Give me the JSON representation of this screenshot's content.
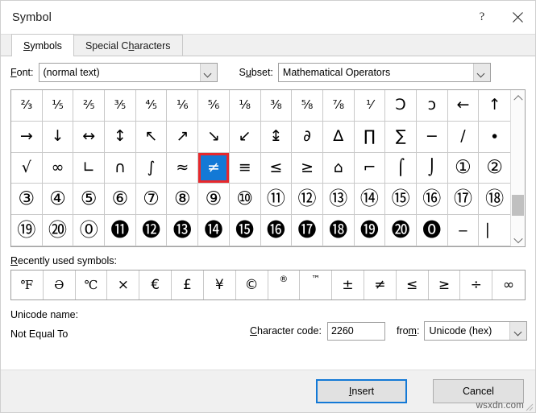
{
  "window": {
    "title": "Symbol",
    "help_icon": "help-icon",
    "close_icon": "close-icon"
  },
  "tabs": [
    {
      "label": "Symbols",
      "accel_index": 0,
      "active": true
    },
    {
      "label": "Special Characters",
      "accel_index": 9,
      "active": false
    }
  ],
  "fields": {
    "font_label": "Font:",
    "font_label_accel": 0,
    "font_value": "(normal text)",
    "subset_label": "Subset:",
    "subset_label_accel": 1,
    "subset_value": "Mathematical Operators",
    "character_code_label": "Character code:",
    "character_code_accel": 0,
    "character_code_value": "2260",
    "from_label": "from:",
    "from_label_accel": 3,
    "from_value": "Unicode (hex)",
    "unicode_name_label": "Unicode name:",
    "unicode_name_value": "Not Equal To"
  },
  "grid": {
    "columns": 16,
    "rows": 5,
    "selected_index": 38,
    "selected_char": "≠",
    "selection_fill": "#1379d6",
    "selection_border": "#e8282c",
    "cells": [
      {
        "ch": "⅔",
        "cls": "small"
      },
      {
        "ch": "⅕",
        "cls": "small"
      },
      {
        "ch": "⅖",
        "cls": "small"
      },
      {
        "ch": "⅗",
        "cls": "small"
      },
      {
        "ch": "⅘",
        "cls": "small"
      },
      {
        "ch": "⅙",
        "cls": "small"
      },
      {
        "ch": "⅚",
        "cls": "small"
      },
      {
        "ch": "⅛",
        "cls": "small"
      },
      {
        "ch": "⅜",
        "cls": "small"
      },
      {
        "ch": "⅝",
        "cls": "small"
      },
      {
        "ch": "⅞",
        "cls": "small"
      },
      {
        "ch": "⅟",
        "cls": "small"
      },
      {
        "ch": "Ↄ",
        "cls": ""
      },
      {
        "ch": "ɔ",
        "cls": ""
      },
      {
        "ch": "←",
        "cls": ""
      },
      {
        "ch": "↑",
        "cls": ""
      },
      {
        "ch": "→",
        "cls": ""
      },
      {
        "ch": "↓",
        "cls": ""
      },
      {
        "ch": "↔",
        "cls": ""
      },
      {
        "ch": "↕",
        "cls": ""
      },
      {
        "ch": "↖",
        "cls": ""
      },
      {
        "ch": "↗",
        "cls": ""
      },
      {
        "ch": "↘",
        "cls": ""
      },
      {
        "ch": "↙",
        "cls": ""
      },
      {
        "ch": "↨",
        "cls": ""
      },
      {
        "ch": "∂",
        "cls": ""
      },
      {
        "ch": "∆",
        "cls": ""
      },
      {
        "ch": "∏",
        "cls": ""
      },
      {
        "ch": "∑",
        "cls": ""
      },
      {
        "ch": "−",
        "cls": ""
      },
      {
        "ch": "∕",
        "cls": ""
      },
      {
        "ch": "∙",
        "cls": ""
      },
      {
        "ch": "√",
        "cls": ""
      },
      {
        "ch": "∞",
        "cls": ""
      },
      {
        "ch": "∟",
        "cls": ""
      },
      {
        "ch": "∩",
        "cls": ""
      },
      {
        "ch": "∫",
        "cls": ""
      },
      {
        "ch": "≈",
        "cls": ""
      },
      {
        "ch": "≠",
        "cls": "selected"
      },
      {
        "ch": "≡",
        "cls": ""
      },
      {
        "ch": "≤",
        "cls": ""
      },
      {
        "ch": "≥",
        "cls": ""
      },
      {
        "ch": "⌂",
        "cls": ""
      },
      {
        "ch": "⌐",
        "cls": ""
      },
      {
        "ch": "⌠",
        "cls": ""
      },
      {
        "ch": "⌡",
        "cls": ""
      },
      {
        "ch": "①",
        "cls": "circ"
      },
      {
        "ch": "②",
        "cls": "circ"
      },
      {
        "ch": "③",
        "cls": "circ"
      },
      {
        "ch": "④",
        "cls": "circ"
      },
      {
        "ch": "⑤",
        "cls": "circ"
      },
      {
        "ch": "⑥",
        "cls": "circ"
      },
      {
        "ch": "⑦",
        "cls": "circ"
      },
      {
        "ch": "⑧",
        "cls": "circ"
      },
      {
        "ch": "⑨",
        "cls": "circ"
      },
      {
        "ch": "⑩",
        "cls": "circ"
      },
      {
        "ch": "⑪",
        "cls": "circ"
      },
      {
        "ch": "⑫",
        "cls": "circ"
      },
      {
        "ch": "⑬",
        "cls": "circ"
      },
      {
        "ch": "⑭",
        "cls": "circ"
      },
      {
        "ch": "⑮",
        "cls": "circ"
      },
      {
        "ch": "⑯",
        "cls": "circ"
      },
      {
        "ch": "⑰",
        "cls": "circ"
      },
      {
        "ch": "⑱",
        "cls": "circ"
      },
      {
        "ch": "⑲",
        "cls": "circ"
      },
      {
        "ch": "⑳",
        "cls": "circ"
      },
      {
        "ch": "⓪",
        "cls": "circ"
      },
      {
        "ch": "⓫",
        "cls": "circ"
      },
      {
        "ch": "⓬",
        "cls": "circ"
      },
      {
        "ch": "⓭",
        "cls": "circ"
      },
      {
        "ch": "⓮",
        "cls": "circ"
      },
      {
        "ch": "⓯",
        "cls": "circ"
      },
      {
        "ch": "⓰",
        "cls": "circ"
      },
      {
        "ch": "⓱",
        "cls": "circ"
      },
      {
        "ch": "⓲",
        "cls": "circ"
      },
      {
        "ch": "⓳",
        "cls": "circ"
      },
      {
        "ch": "⓴",
        "cls": "circ"
      },
      {
        "ch": "⓿",
        "cls": "circ"
      },
      {
        "ch": "‒",
        "cls": ""
      },
      {
        "ch": "⎸",
        "cls": ""
      }
    ]
  },
  "recent": {
    "label": "Recently used symbols:",
    "label_accel": 0,
    "cells": [
      {
        "ch": "℉",
        "cls": "serif"
      },
      {
        "ch": "Ә",
        "cls": "serif"
      },
      {
        "ch": "℃",
        "cls": "serif"
      },
      {
        "ch": "×",
        "cls": ""
      },
      {
        "ch": "€",
        "cls": ""
      },
      {
        "ch": "£",
        "cls": ""
      },
      {
        "ch": "¥",
        "cls": ""
      },
      {
        "ch": "©",
        "cls": ""
      },
      {
        "ch": "®",
        "cls": "sup"
      },
      {
        "ch": "™",
        "cls": "sup"
      },
      {
        "ch": "±",
        "cls": ""
      },
      {
        "ch": "≠",
        "cls": ""
      },
      {
        "ch": "≤",
        "cls": ""
      },
      {
        "ch": "≥",
        "cls": ""
      },
      {
        "ch": "÷",
        "cls": ""
      },
      {
        "ch": "∞",
        "cls": ""
      }
    ]
  },
  "scrollbar": {
    "up_icon": "chevron-up-icon",
    "down_icon": "chevron-down-icon"
  },
  "footer": {
    "insert_label": "Insert",
    "insert_accel": 0,
    "cancel_label": "Cancel",
    "watermark": "wsxdn.com"
  }
}
